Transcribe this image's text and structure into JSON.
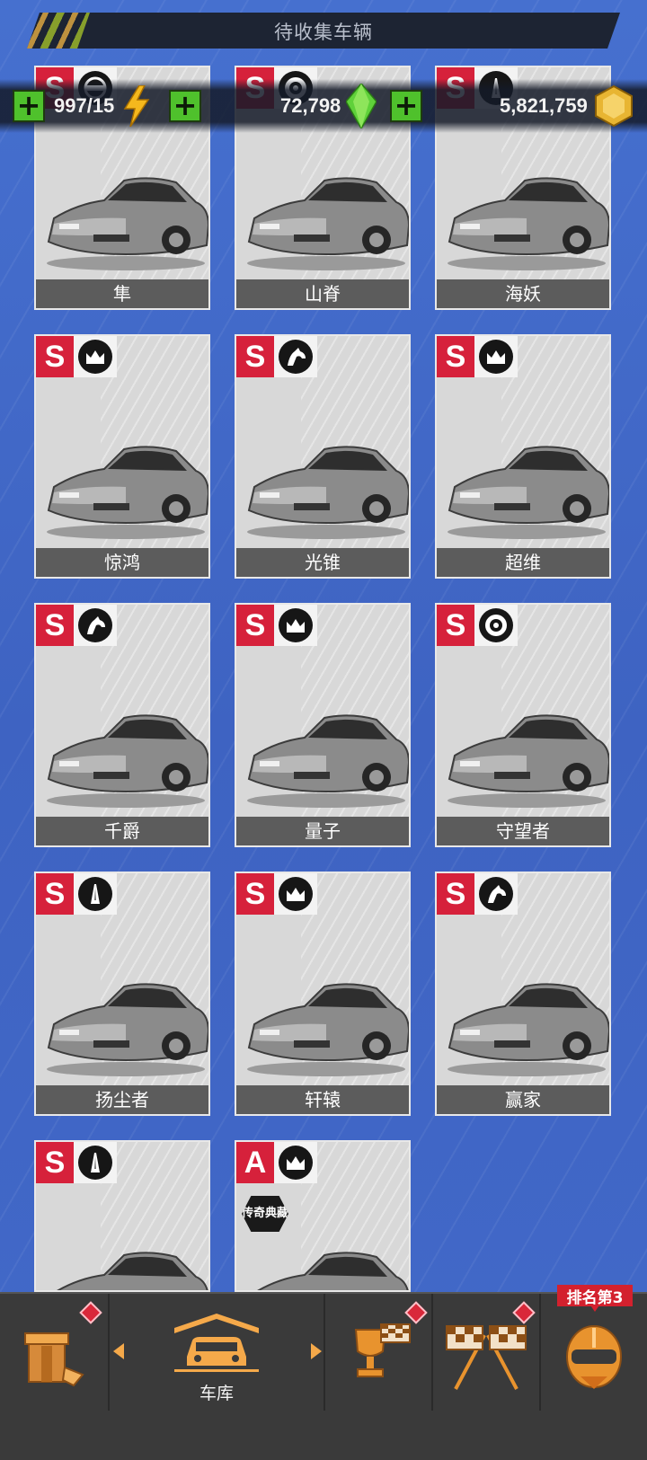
{
  "header": {
    "title": "待收集车辆"
  },
  "resources": {
    "energy": {
      "value": "997/15",
      "icon": "lightning-icon"
    },
    "gems": {
      "value": "72,798",
      "icon": "gem-icon"
    },
    "coins": {
      "value": "5,821,759",
      "icon": "coin-icon"
    }
  },
  "cars": [
    {
      "name": "隼",
      "tier": "S",
      "brand_icon": "nissan-icon"
    },
    {
      "name": "山脊",
      "tier": "S",
      "brand_icon": "wheel-icon"
    },
    {
      "name": "海妖",
      "tier": "S",
      "brand_icon": "road-icon"
    },
    {
      "name": "惊鸿",
      "tier": "S",
      "brand_icon": "crown-icon"
    },
    {
      "name": "光锥",
      "tier": "S",
      "brand_icon": "horse-icon"
    },
    {
      "name": "超维",
      "tier": "S",
      "brand_icon": "crown-icon"
    },
    {
      "name": "千爵",
      "tier": "S",
      "brand_icon": "horse-icon"
    },
    {
      "name": "量子",
      "tier": "S",
      "brand_icon": "crown-icon"
    },
    {
      "name": "守望者",
      "tier": "S",
      "brand_icon": "wheel-icon"
    },
    {
      "name": "扬尘者",
      "tier": "S",
      "brand_icon": "road-icon"
    },
    {
      "name": "轩辕",
      "tier": "S",
      "brand_icon": "crown-icon"
    },
    {
      "name": "赢家",
      "tier": "S",
      "brand_icon": "horse-icon"
    },
    {
      "name": "",
      "tier": "S",
      "brand_icon": "road-icon"
    },
    {
      "name": "",
      "tier": "A",
      "brand_icon": "crown-icon",
      "badge": "传奇典藏"
    }
  ],
  "nav": {
    "garage_label": "车库",
    "rank_tag": "排名第3",
    "items": [
      "shop-icon",
      "garage-icon",
      "trophy-icon",
      "race-flags-icon",
      "helmet-icon"
    ]
  }
}
